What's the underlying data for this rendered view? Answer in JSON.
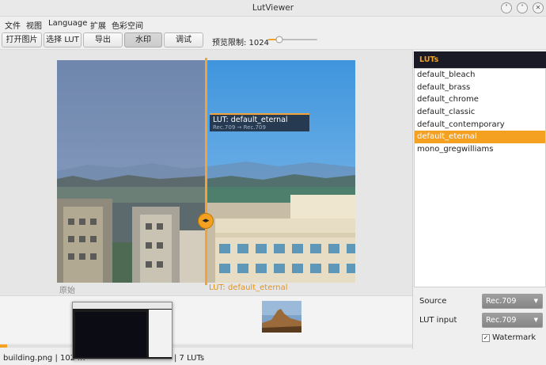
{
  "window": {
    "title": "LutViewer",
    "controls": {
      "minimize": "˅",
      "maximize": "˄",
      "close": "✕"
    }
  },
  "menubar": {
    "items": [
      "文件",
      "视图",
      "Language",
      "扩展",
      "色彩空间"
    ]
  },
  "toolbar": {
    "buttons": [
      "打开图片",
      "选择 LUT",
      "导出",
      "水印",
      "调试"
    ],
    "active_button": "水印",
    "zoom_label": "预览限制: 1024",
    "zoom_slider_fraction": 0.18
  },
  "viewer": {
    "overlay_name": "LUT: default_eternal",
    "overlay_sub": "Rec.709 → Rec.709",
    "split_handle_glyph": "◂▸",
    "label_original": "原始",
    "label_lut": "LUT: default_eternal",
    "split_fraction": 0.5
  },
  "filmstrip": {
    "scroll_fraction": 0.0
  },
  "status": {
    "text": "building.png | 1024x",
    "text_right": "| 7 LUTs"
  },
  "luts": {
    "header": "LUTs",
    "items": [
      "default_bleach",
      "default_brass",
      "default_chrome",
      "default_classic",
      "default_contemporary",
      "default_eternal",
      "mono_gregwilliams"
    ],
    "selected_index": 5
  },
  "settings": {
    "source_label": "Source",
    "source_value": "Rec.709",
    "lut_input_label": "LUT input",
    "lut_input_value": "Rec.709",
    "watermark_label": "Watermark",
    "watermark_checked": true,
    "check_glyph": "✓"
  },
  "colors": {
    "accent": "#f4a020",
    "panel_header_bg": "#1a1a26",
    "sky_left": "#7990b4",
    "sky_right": "#5aa9e6"
  }
}
